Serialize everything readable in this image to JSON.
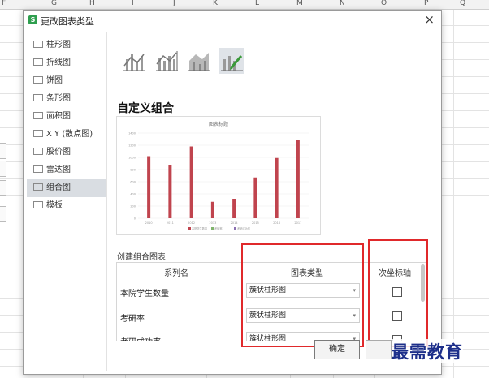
{
  "spreadsheet": {
    "columns": [
      "F",
      "G",
      "H",
      "I",
      "J",
      "K",
      "L",
      "M",
      "N",
      "O",
      "P",
      "Q"
    ]
  },
  "dialog": {
    "title": "更改图表类型",
    "close_glyph": "×"
  },
  "chart_types": [
    {
      "label": "柱形图"
    },
    {
      "label": "折线图"
    },
    {
      "label": "饼图"
    },
    {
      "label": "条形图"
    },
    {
      "label": "面积图"
    },
    {
      "label": "X Y (散点图)"
    },
    {
      "label": "股价图"
    },
    {
      "label": "雷达图"
    },
    {
      "label": "组合图"
    },
    {
      "label": "模板"
    }
  ],
  "selected_type": "组合图",
  "section_title": "自定义组合",
  "create_label": "创建组合图表",
  "table": {
    "headers": [
      "系列名",
      "图表类型",
      "次坐标轴"
    ],
    "rows": [
      {
        "name": "本院学生数量",
        "type": "簇状柱形图"
      },
      {
        "name": "考研率",
        "type": "簇状柱形图"
      },
      {
        "name": "考研成功率",
        "type": "簇状柱形图"
      }
    ]
  },
  "buttons": {
    "ok": "确定"
  },
  "watermark": "最需教育",
  "colors": {
    "bar": "#c0444e",
    "highlight": "#e0292b",
    "accent": "#2e9e4e"
  },
  "chart_data": {
    "type": "bar",
    "title": "图表标题",
    "categories": [
      "2010",
      "2011",
      "2012",
      "2013",
      "2014",
      "2015",
      "2016",
      "2017"
    ],
    "values": [
      1020,
      870,
      1180,
      270,
      320,
      670,
      990,
      1290
    ],
    "ylim": [
      0,
      1400
    ],
    "yticks": [
      "1400",
      "1200",
      "1000",
      "800",
      "600",
      "400",
      "200",
      "0"
    ],
    "legend": [
      "本院学生数量",
      "考研率",
      "考研成功率"
    ]
  }
}
